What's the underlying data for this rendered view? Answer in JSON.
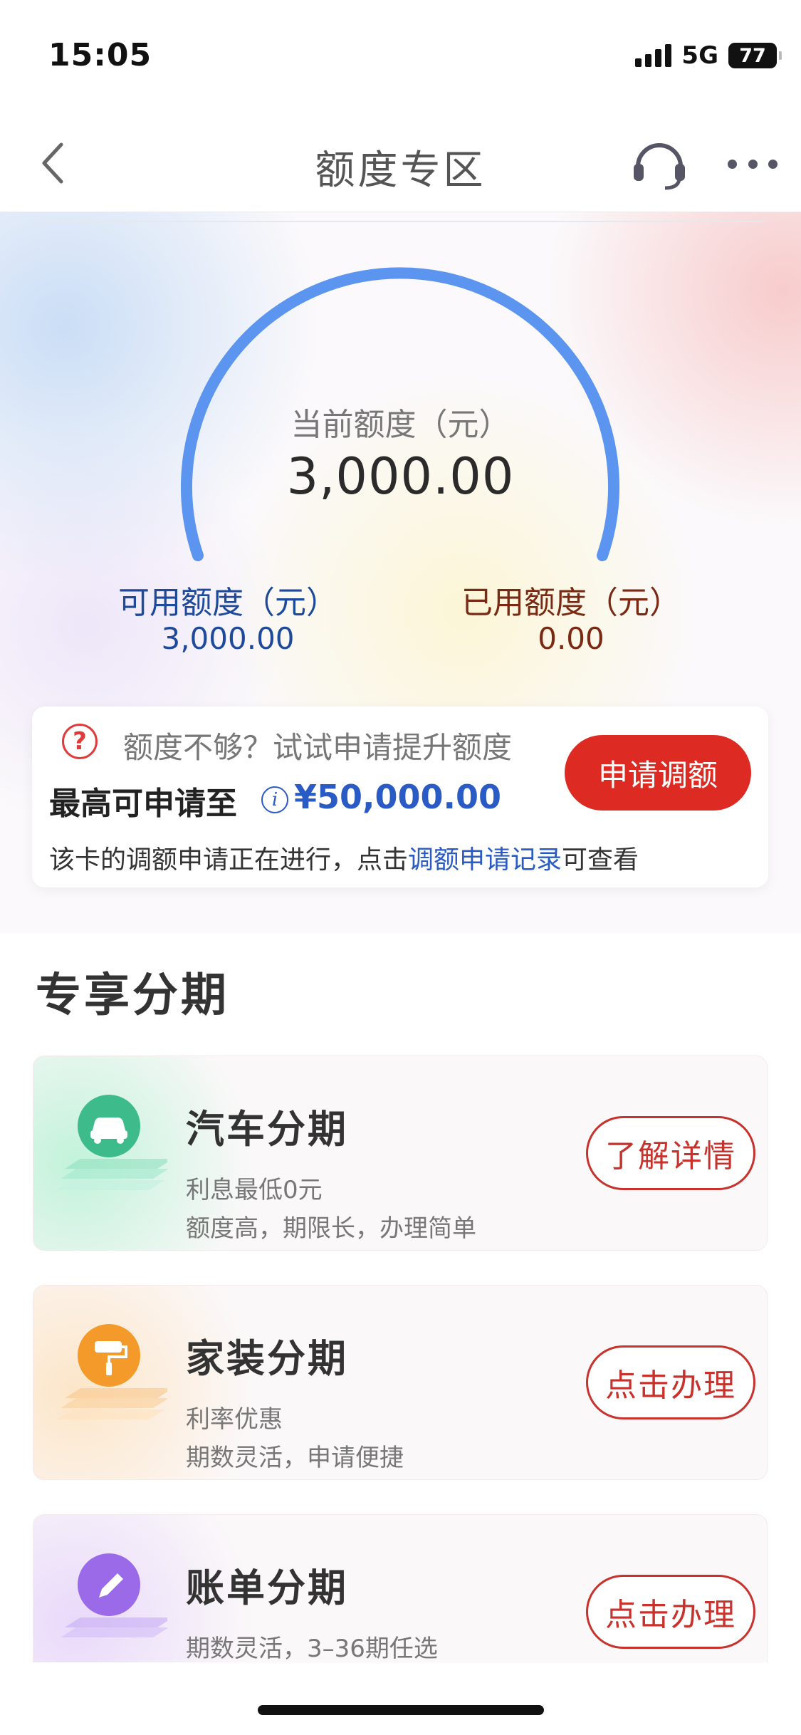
{
  "status_bar": {
    "time": "15:05",
    "network": "5G",
    "battery": "77"
  },
  "nav": {
    "title": "额度专区",
    "back_icon": "chevron-left-icon",
    "service_icon": "headset-icon",
    "more_icon": "more-dots-icon"
  },
  "credit": {
    "current_label": "当前额度（元）",
    "current_value": "3,000.00",
    "available_label": "可用额度（元）",
    "available_value": "3,000.00",
    "used_label": "已用额度（元）",
    "used_value": "0.00",
    "gauge_color": "#5b95f0"
  },
  "apply": {
    "hint": "额度不够？试试申请提升额度",
    "max_label": "最高可申请至",
    "max_value": "¥50,000.00",
    "button": "申请调额",
    "note_prefix": "该卡的调额申请正在进行，点击",
    "note_link": "调额申请记录",
    "note_suffix": "可查看",
    "help_icon": "question-circle-icon",
    "info_icon": "info-icon"
  },
  "section": {
    "title": "专享分期"
  },
  "installments": [
    {
      "title": "汽车分期",
      "line1": "利息最低0元",
      "line2": "额度高，期限长，办理简单",
      "button": "了解详情",
      "icon": "car-icon",
      "color": "#3dbb8a"
    },
    {
      "title": "家装分期",
      "line1": "利率优惠",
      "line2": "期数灵活，申请便捷",
      "button": "点击办理",
      "icon": "paint-roller-icon",
      "color": "#f39a2a"
    },
    {
      "title": "账单分期",
      "line1": "期数灵活，3–36期任选",
      "line2": "",
      "button": "点击办理",
      "icon": "pencil-icon",
      "color": "#9b6ae8"
    }
  ]
}
